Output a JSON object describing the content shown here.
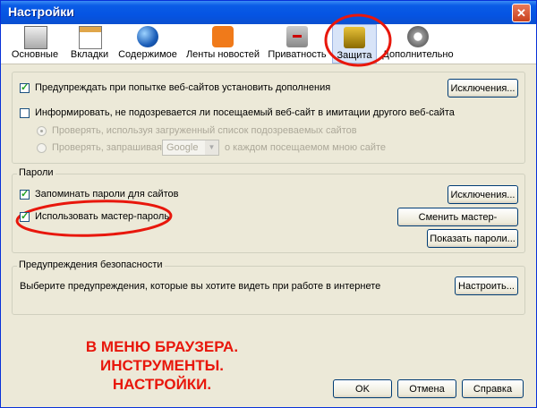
{
  "window": {
    "title": "Настройки",
    "close_label": "✕"
  },
  "tabs": [
    {
      "label": "Основные"
    },
    {
      "label": "Вкладки"
    },
    {
      "label": "Содержимое"
    },
    {
      "label": "Ленты новостей"
    },
    {
      "label": "Приватность"
    },
    {
      "label": "Защита",
      "active": true
    },
    {
      "label": "Дополнительно"
    }
  ],
  "general": {
    "warn_addons": {
      "label": "Предупреждать при попытке веб-сайтов установить дополнения",
      "checked": true
    },
    "exceptions_button": "Исключения...",
    "report_forgery": {
      "label": "Информировать, не подозревается ли посещаемый веб-сайт в имитации другого веб-сайта",
      "checked": false
    },
    "radio_local": "Проверять, используя загруженный список подозреваемых сайтов",
    "radio_ask_prefix": "Проверять, запрашивая",
    "radio_ask_suffix": "о каждом посещаемом мною сайте",
    "provider": "Google"
  },
  "passwords": {
    "legend": "Пароли",
    "remember": {
      "label": "Запоминать пароли для сайтов",
      "checked": true
    },
    "exceptions_button": "Исключения...",
    "master": {
      "label": "Использовать мастер-пароль",
      "checked": true
    },
    "change_master_button": "Сменить мастер-пароль...",
    "show_passwords_button": "Показать пароли..."
  },
  "warnings": {
    "legend": "Предупреждения безопасности",
    "text": "Выберите предупреждения, которые вы хотите видеть при работе в интернете",
    "settings_button": "Настроить..."
  },
  "annotation": {
    "lines": [
      "В МЕНЮ БРАУЗЕРА.",
      "ИНСТРУМЕНТЫ.",
      "НАСТРОЙКИ."
    ]
  },
  "footer": {
    "ok": "OK",
    "cancel": "Отмена",
    "help": "Справка"
  },
  "colors": {
    "highlight": "#e8170c",
    "title_bar": "#0554e3"
  }
}
